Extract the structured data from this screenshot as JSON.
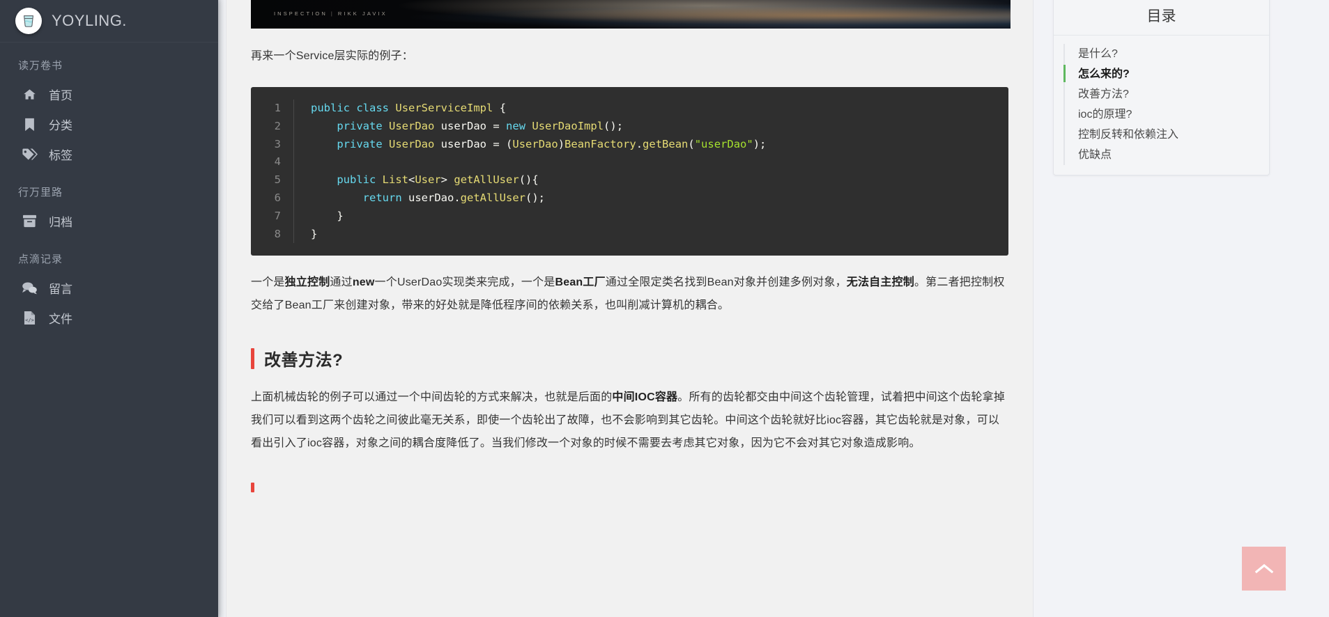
{
  "sidebar": {
    "brand": {
      "name": "YOYLING.",
      "logo_icon": "water-glass-icon"
    },
    "sections": [
      {
        "title": "读万卷书",
        "items": [
          {
            "label": "首页",
            "icon": "home-icon"
          },
          {
            "label": "分类",
            "icon": "bookmark-icon"
          },
          {
            "label": "标签",
            "icon": "tags-icon"
          }
        ]
      },
      {
        "title": "行万里路",
        "items": [
          {
            "label": "归档",
            "icon": "archive-icon"
          }
        ]
      },
      {
        "title": "点滴记录",
        "items": [
          {
            "label": "留言",
            "icon": "comments-icon"
          },
          {
            "label": "文件",
            "icon": "file-code-icon"
          }
        ]
      }
    ]
  },
  "article": {
    "banner": {
      "caption_left": "INSPECTION",
      "caption_right": "RIKK JAVIX"
    },
    "lead_paragraph": "再来一个Service层实际的例子：",
    "code": {
      "language": "java",
      "line_numbers": [
        "1",
        "2",
        "3",
        "4",
        "5",
        "6",
        "7",
        "8"
      ],
      "lines": [
        "public class UserServiceImpl {",
        "    private UserDao userDao = new UserDaoImpl();",
        "    private UserDao userDao = (UserDao)BeanFactory.getBean(\"userDao\");",
        "",
        "    public List<User> getAllUser(){",
        "        return userDao.getAllUser();",
        "    }",
        "}"
      ]
    },
    "paragraph_after_code_part1": "一个是",
    "paragraph_after_code_b1": "独立控制",
    "paragraph_after_code_part2": "通过",
    "paragraph_after_code_b2": "new",
    "paragraph_after_code_part3": "一个UserDao实现类来完成，一个是",
    "paragraph_after_code_b3": "Bean工厂",
    "paragraph_after_code_part4": "通过全限定类名找到Bean对象并创建多例对象，",
    "paragraph_after_code_b4": "无法自主控制",
    "paragraph_after_code_part5": "。第二者把控制权交给了Bean工厂来创建对象，带来的好处就是降低程序间的依赖关系，也叫削减计算机的耦合。",
    "heading_improve": "改善方法?",
    "paragraph_improve_part1": "上面机械齿轮的例子可以通过一个中间齿轮的方式来解决，也就是后面的",
    "paragraph_improve_b1": "中间IOC容器",
    "paragraph_improve_part2": "。所有的齿轮都交由中间这个齿轮管理，试着把中间这个齿轮拿掉我们可以看到这两个齿轮之间彼此毫无关系，即使一个齿轮出了故障，也不会影响到其它齿轮。中间这个齿轮就好比ioc容器，其它齿轮就是对象，可以看出引入了ioc容器，对象之间的耦合度降低了。当我们修改一个对象的时候不需要去考虑其它对象，因为它不会对其它对象造成影响。"
  },
  "toc": {
    "title": "目录",
    "items": [
      {
        "label": "是什么?",
        "active": false
      },
      {
        "label": "怎么来的?",
        "active": true
      },
      {
        "label": "改善方法?",
        "active": false
      },
      {
        "label": "ioc的原理?",
        "active": false
      },
      {
        "label": "控制反转和依赖注入",
        "active": false
      },
      {
        "label": "优缺点",
        "active": false
      }
    ]
  },
  "back_to_top": {
    "icon": "chevron-up-icon",
    "label": ""
  },
  "colors": {
    "sidebar_bg": "#343a44",
    "article_bg": "#f1f1f1",
    "page_bg": "#f2f3f7",
    "heading_accent": "#e8453c",
    "toc_active_accent": "#5fb85f",
    "back_to_top_bg": "#f2b5b5",
    "code_bg": "#2f2f2f",
    "code_keyword": "#66d9ef",
    "code_type": "#e6db74",
    "code_string": "#a6e22e"
  }
}
